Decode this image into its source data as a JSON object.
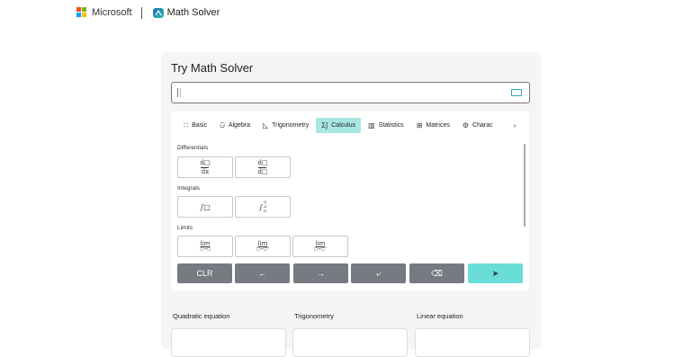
{
  "header": {
    "brand": "Microsoft",
    "app_name": "Math Solver",
    "brand_colors": [
      "#f25022",
      "#7fba00",
      "#00a4ef",
      "#ffb900"
    ]
  },
  "card": {
    "title": "Try Math Solver",
    "input": {
      "value": "",
      "icon": "keyboard-icon"
    }
  },
  "tabs": [
    {
      "label": "Basic",
      "icon": "∷",
      "active": false
    },
    {
      "label": "Algebra",
      "icon": "⩂",
      "active": false
    },
    {
      "label": "Trigonometry",
      "icon": "◺",
      "active": false
    },
    {
      "label": "Calculus",
      "icon": "Σ∫",
      "active": true
    },
    {
      "label": "Statistics",
      "icon": "▥",
      "active": false
    },
    {
      "label": "Matrices",
      "icon": "⊞",
      "active": false
    },
    {
      "label": "Charac",
      "icon": "⚙",
      "active": false
    }
  ],
  "sections": {
    "differentials": "Differentials",
    "integrals": "Integrals",
    "limits": "Limits"
  },
  "keys": {
    "d_num": "d□",
    "dx": "dx",
    "d_box": "d□",
    "int1": "∫□",
    "int2": "∫",
    "lim": "lim",
    "lim_sub1": "□→□",
    "lim_sub2": "□→□⁺",
    "lim_sub3": "□→□⁻"
  },
  "controls": {
    "clear": "CLR",
    "left": "←",
    "right": "→",
    "newline": "⤶",
    "backspace": "⌫",
    "solve": "➤"
  },
  "examples": [
    "Quadratic equation",
    "Trigonometry",
    "Linear equation"
  ],
  "accent": "#69ddd6"
}
